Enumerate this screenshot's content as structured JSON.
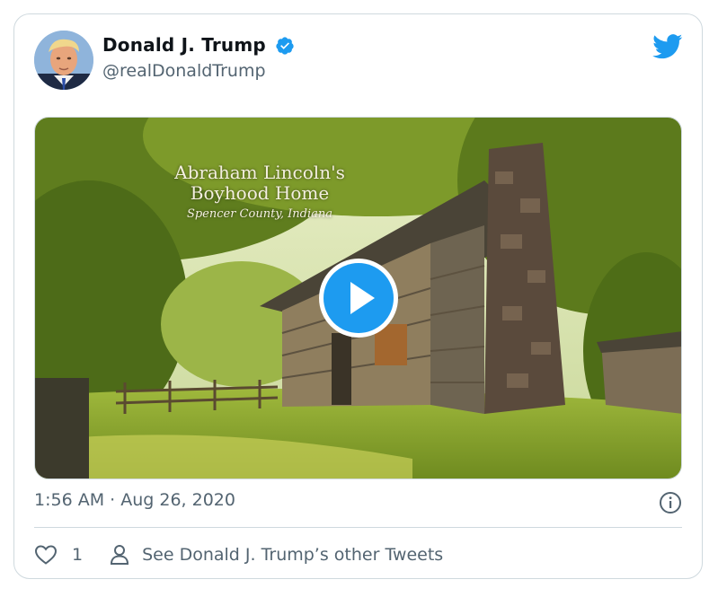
{
  "tweet": {
    "author_name": "Donald J. Trump",
    "handle": "@realDonaldTrump",
    "verified": true,
    "timestamp": "1:56 AM · Aug 26, 2020",
    "likes": "1",
    "other_tweets_label": "See Donald J. Trump’s other Tweets"
  },
  "video": {
    "overlay_title": "Abraham Lincoln's",
    "overlay_title_line2": "Boyhood Home",
    "overlay_subtitle": "Spencer County, Indiana"
  },
  "icons": {
    "verified": "verified-badge-icon",
    "brand": "twitter-bird-icon",
    "play": "play-icon",
    "info": "info-icon",
    "like": "heart-icon",
    "profile": "person-icon"
  },
  "colors": {
    "accent": "#1d9bf0",
    "text_secondary": "#536471",
    "border": "#cfd9de"
  }
}
